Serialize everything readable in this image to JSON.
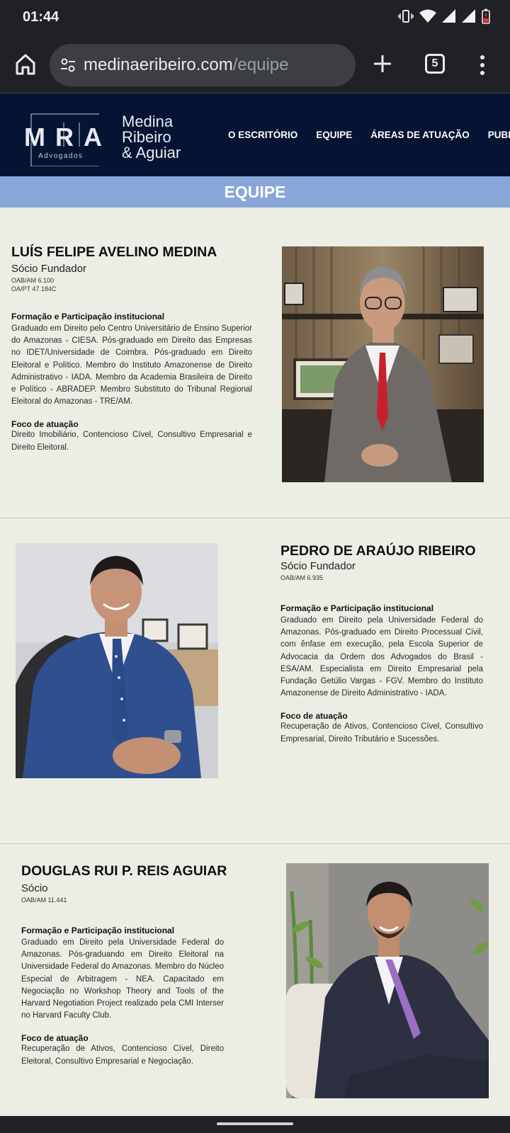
{
  "status": {
    "time": "01:44"
  },
  "browser": {
    "url_domain": "medinaeribeiro.com",
    "url_path": "/equipe",
    "tab_count": "5"
  },
  "header": {
    "logo_letters": [
      "M",
      "R",
      "A"
    ],
    "logo_sub": "Advogados",
    "brand_lines": [
      "Medina",
      "Ribeiro",
      "& Aguiar"
    ],
    "nav": [
      "O ESCRITÓRIO",
      "EQUIPE",
      "ÁREAS DE ATUAÇÃO",
      "PUBLICAÇÕES"
    ]
  },
  "page_title": "EQUIPE",
  "members": [
    {
      "name": "LUÍS FELIPE AVELINO MEDINA",
      "role": "Sócio Fundador",
      "oab": [
        "OAB/AM 6.100",
        "OA/PT 47.184C"
      ],
      "education_heading": "Formação e Participação institucional",
      "education_text": "Graduado em Direito pelo Centro Universitário de Ensino Superior do Amazonas - CIESA. Pós-graduado em Direito das Empresas no IDET/Universidade de Coimbra. Pós-graduado em Direito Eleitoral e Político. Membro do Instituto Amazonense de Direito Administrativo - IADA. Membro da Academia Brasileira de Direito e Político - ABRADEP. Membro Substituto do Tribunal Regional Eleitoral do Amazonas - TRE/AM.",
      "focus_heading": "Foco de atuação",
      "focus_text": "Direito Imobiliário, Contencioso Cível, Consultivo Empresarial e Direito Eleitoral."
    },
    {
      "name": "PEDRO DE ARAÚJO RIBEIRO",
      "role": "Sócio Fundador",
      "oab": [
        "OAB/AM 6.935"
      ],
      "education_heading": "Formação e Participação institucional",
      "education_text": "Graduado em Direito pela Universidade Federal do Amazonas. Pós-graduado em Direito Processual Civil, com ênfase em execução, pela Escola Superior de Advocacia da Ordem dos Advogados do Brasil - ESA/AM. Especialista em Direito Empresarial pela Fundação Getúlio Vargas - FGV. Membro do Instituto Amazonense de Direito Administrativo - IADA.",
      "focus_heading": "Foco de atuação",
      "focus_text": "Recuperação de Ativos, Contencioso Cível, Consultivo Empresarial, Direito Tributário e Sucessões."
    },
    {
      "name": "DOUGLAS RUI P. REIS AGUIAR",
      "role": "Sócio",
      "oab": [
        "OAB/AM 11.441"
      ],
      "education_heading": "Formação e Participação institucional",
      "education_text": "Graduado em Direito pela Universidade Federal do Amazonas. Pós-graduando em Direito Eleitoral na Universidade Federal do Amazonas. Membro do Núcleo Especial de Arbitragem - NEA. Capacitado em Negociação no Workshop Theory and Tools of the Harvard Negotiation Project realizado pela CMI Interser no Harvard Faculty Club.",
      "focus_heading": "Foco de atuação",
      "focus_text": "Recuperação de Ativos, Contencioso Cível, Direito Eleitoral, Consultivo Empresarial e Negociação."
    }
  ],
  "colors": {
    "header_bg": "#051433",
    "banner_bg": "#88a6d7",
    "content_bg": "#ecede4",
    "chrome_bg": "#202124"
  }
}
